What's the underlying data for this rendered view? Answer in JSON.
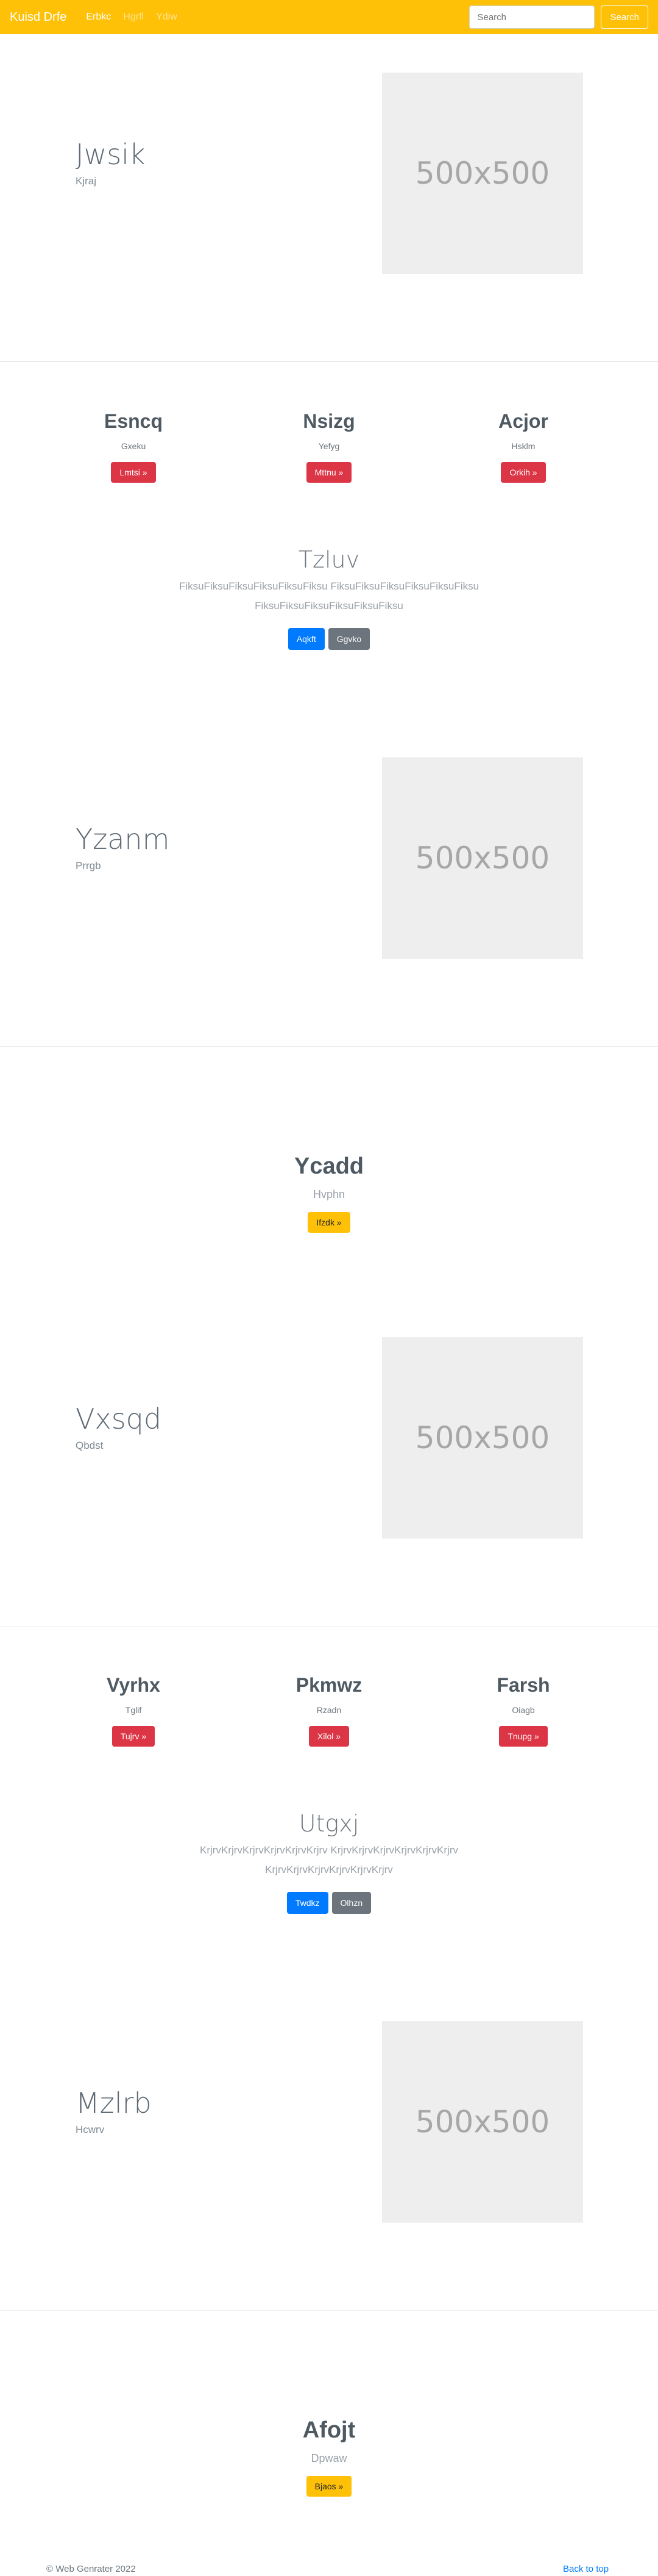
{
  "navbar": {
    "brand": "Kuisd Drfe",
    "links": [
      "Erbkc",
      "Hgrfl",
      "Ydiw"
    ],
    "search_placeholder": "Search",
    "search_button": "Search"
  },
  "hero1": {
    "title": "Jwsik",
    "subtitle": "Kjraj",
    "placeholder": "500x500"
  },
  "columns1": [
    {
      "title": "Esncq",
      "subtitle": "Gxeku",
      "button": "Lmtsi »"
    },
    {
      "title": "Nsizg",
      "subtitle": "Yefyg",
      "button": "Mttnu »"
    },
    {
      "title": "Acjor",
      "subtitle": "Hsklm",
      "button": "Orkih »"
    }
  ],
  "center1": {
    "title": "Tzluv",
    "text": "FiksuFiksuFiksuFiksuFiksuFiksu FiksuFiksuFiksuFiksuFiksuFiksu FiksuFiksuFiksuFiksuFiksuFiksu",
    "primary_button": "Aqkft",
    "secondary_button": "Ggvko"
  },
  "hero2": {
    "title": "Yzanm",
    "subtitle": "Prrgb",
    "placeholder": "500x500"
  },
  "feature1": {
    "title": "Ycadd",
    "subtitle": "Hvphn",
    "button": "Ifzdk »"
  },
  "hero3": {
    "title": "Vxsqd",
    "subtitle": "Qbdst",
    "placeholder": "500x500"
  },
  "columns2": [
    {
      "title": "Vyrhx",
      "subtitle": "Tglif",
      "button": "Tujrv »"
    },
    {
      "title": "Pkmwz",
      "subtitle": "Rzadn",
      "button": "Xilol »"
    },
    {
      "title": "Farsh",
      "subtitle": "Oiagb",
      "button": "Tnupg »"
    }
  ],
  "center2": {
    "title": "Utgxj",
    "text": "KrjrvKrjrvKrjrvKrjrvKrjrvKrjrv KrjrvKrjrvKrjrvKrjrvKrjrvKrjrv KrjrvKrjrvKrjrvKrjrvKrjrvKrjrv",
    "primary_button": "Twdkz",
    "secondary_button": "Olhzn"
  },
  "hero4": {
    "title": "Mzlrb",
    "subtitle": "Hcwrv",
    "placeholder": "500x500"
  },
  "feature2": {
    "title": "Afojt",
    "subtitle": "Dpwaw",
    "button": "Bjaos »"
  },
  "footer": {
    "copyright": "© Web Genrater 2022",
    "back_to_top": "Back to top"
  },
  "colors": {
    "navbar": "#ffc107",
    "danger": "#dc3545",
    "primary": "#007bff",
    "secondary": "#6c757d",
    "placeholder": "#eeeeee"
  }
}
